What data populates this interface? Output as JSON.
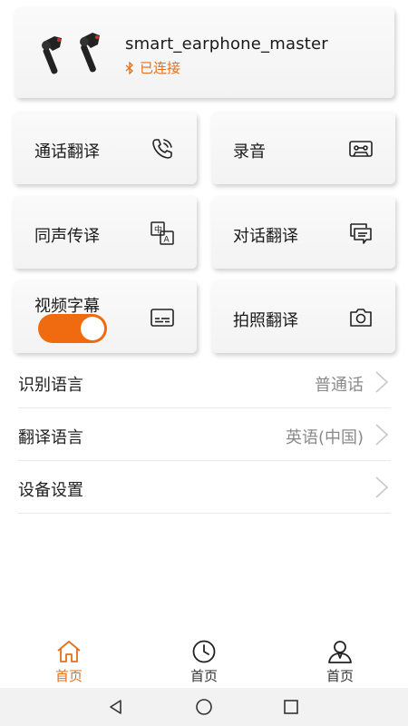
{
  "device": {
    "name": "smart_earphone_master",
    "status": "已连接",
    "image_icon": "earphones-image",
    "status_icon": "bluetooth-icon"
  },
  "tiles": [
    {
      "label": "通话翻译",
      "icon": "phone-call-icon"
    },
    {
      "label": "录音",
      "icon": "cassette-tape-icon"
    },
    {
      "label": "同声传译",
      "icon": "translate-icon"
    },
    {
      "label": "对话翻译",
      "icon": "chat-bubbles-icon"
    },
    {
      "label": "视频字幕",
      "icon": "subtitles-icon",
      "toggle_on": true
    },
    {
      "label": "拍照翻译",
      "icon": "camera-icon"
    }
  ],
  "settings": [
    {
      "label": "识别语言",
      "value": "普通话"
    },
    {
      "label": "翻译语言",
      "value": "英语(中国)"
    },
    {
      "label": "设备设置",
      "value": ""
    }
  ],
  "bottom_nav": [
    {
      "label": "首页",
      "icon": "home-icon",
      "active": true
    },
    {
      "label": "首页",
      "icon": "clock-icon",
      "active": false
    },
    {
      "label": "首页",
      "icon": "user-icon",
      "active": false
    }
  ],
  "colors": {
    "accent": "#f06a0f",
    "status_text": "#e3701c",
    "value_text": "#8a8a8a"
  }
}
